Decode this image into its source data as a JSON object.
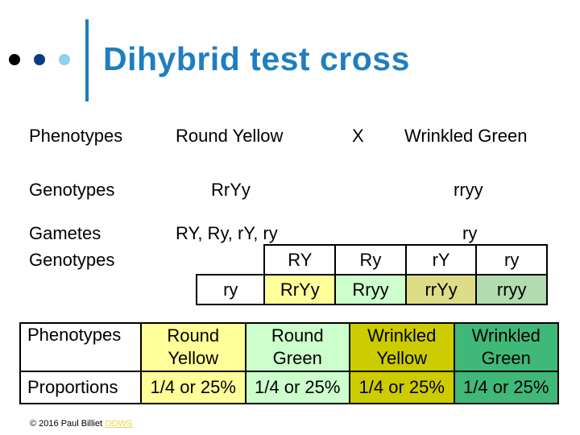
{
  "title": "Dihybrid test cross",
  "bullet_colors": [
    "#000000",
    "#0b3a82",
    "#8fd0f2"
  ],
  "cross": {
    "phenotypes_label": "Phenotypes",
    "parent1_phenotype": "Round Yellow",
    "cross_symbol": "X",
    "parent2_phenotype": "Wrinkled Green",
    "genotypes_label": "Genotypes",
    "parent1_genotype": "RrYy",
    "parent2_genotype": "rryy",
    "gametes_label": "Gametes",
    "parent1_gametes": "RY, Ry, rY, ry",
    "parent2_gametes": "ry",
    "offspring_genotypes_label": "Genotypes"
  },
  "punnett": {
    "header": [
      "RY",
      "Ry",
      "rY",
      "ry"
    ],
    "row_gamete": "ry",
    "cells": [
      {
        "genotype": "RrYy",
        "color": "#ffff99"
      },
      {
        "genotype": "Rryy",
        "color": "#ccffcc"
      },
      {
        "genotype": "rrYy",
        "color": "#dddd88"
      },
      {
        "genotype": "rryy",
        "color": "#b3dbb0"
      }
    ]
  },
  "results": {
    "phenotypes_label": "Phenotypes",
    "proportions_label": "Proportions",
    "columns": [
      {
        "phenotype_line1": "Round",
        "phenotype_line2": "Yellow",
        "proportion": "1/4 or 25%",
        "color": "#ffff99"
      },
      {
        "phenotype_line1": "Round",
        "phenotype_line2": "Green",
        "proportion": "1/4 or 25%",
        "color": "#ccffcc"
      },
      {
        "phenotype_line1": "Wrinkled",
        "phenotype_line2": "Yellow",
        "proportion": "1/4 or 25%",
        "color": "#cccc00"
      },
      {
        "phenotype_line1": "Wrinkled",
        "phenotype_line2": "Green",
        "proportion": "1/4 or 25%",
        "color": "#40b878"
      }
    ]
  },
  "footer": {
    "copyright": "© 2016 Paul Billiet ",
    "link_text": "ODWS"
  }
}
